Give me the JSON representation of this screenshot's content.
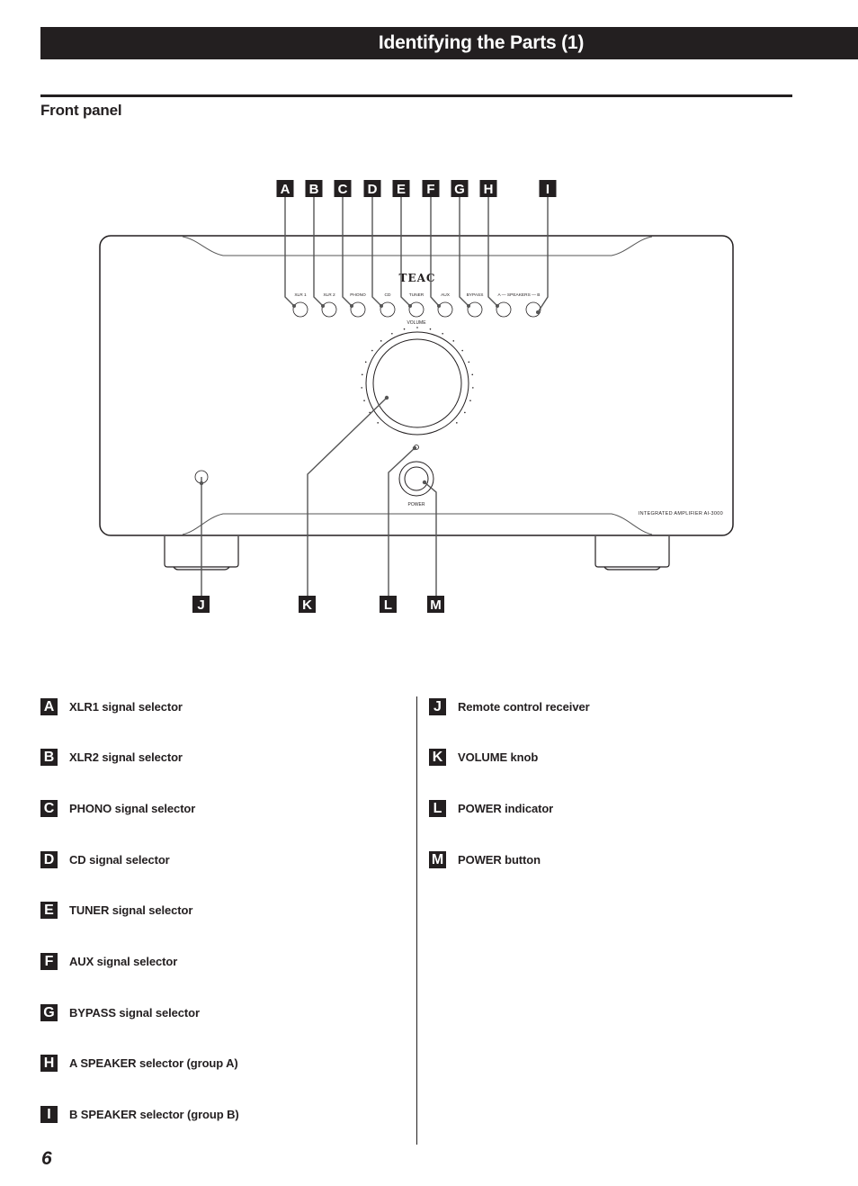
{
  "header": {
    "title": "Identifying the Parts (1)"
  },
  "section": {
    "title": "Front panel"
  },
  "device": {
    "brand": "TEAC",
    "model_text": "INTEGRATED AMPLIFIER AI-3000",
    "volume_label": "VOLUME",
    "power_label": "POWER",
    "buttons": [
      {
        "callout": "A",
        "label": "XLR 1"
      },
      {
        "callout": "B",
        "label": "XLR 2"
      },
      {
        "callout": "C",
        "label": "PHONO"
      },
      {
        "callout": "D",
        "label": "CD"
      },
      {
        "callout": "E",
        "label": "TUNER"
      },
      {
        "callout": "F",
        "label": "AUX"
      },
      {
        "callout": "G",
        "label": "BYPASS"
      },
      {
        "callout": "H",
        "label": "A — SPEAKERS — B"
      },
      {
        "callout": "I",
        "label": ""
      }
    ],
    "bottom_callouts": [
      "J",
      "K",
      "L",
      "M"
    ]
  },
  "legend": {
    "left": [
      {
        "letter": "A",
        "label": "XLR1 signal selector"
      },
      {
        "letter": "B",
        "label": "XLR2 signal selector"
      },
      {
        "letter": "C",
        "label": "PHONO signal selector"
      },
      {
        "letter": "D",
        "label": "CD signal selector"
      },
      {
        "letter": "E",
        "label": "TUNER signal selector"
      },
      {
        "letter": "F",
        "label": "AUX signal selector"
      },
      {
        "letter": "G",
        "label": "BYPASS signal selector"
      },
      {
        "letter": "H",
        "label": "A SPEAKER selector (group A)"
      },
      {
        "letter": "I",
        "label": "B SPEAKER selector (group B)"
      }
    ],
    "right": [
      {
        "letter": "J",
        "label": "Remote control receiver"
      },
      {
        "letter": "K",
        "label": "VOLUME knob"
      },
      {
        "letter": "L",
        "label": "POWER indicator"
      },
      {
        "letter": "M",
        "label": "POWER button"
      }
    ]
  },
  "footer": {
    "page_number": "6"
  }
}
